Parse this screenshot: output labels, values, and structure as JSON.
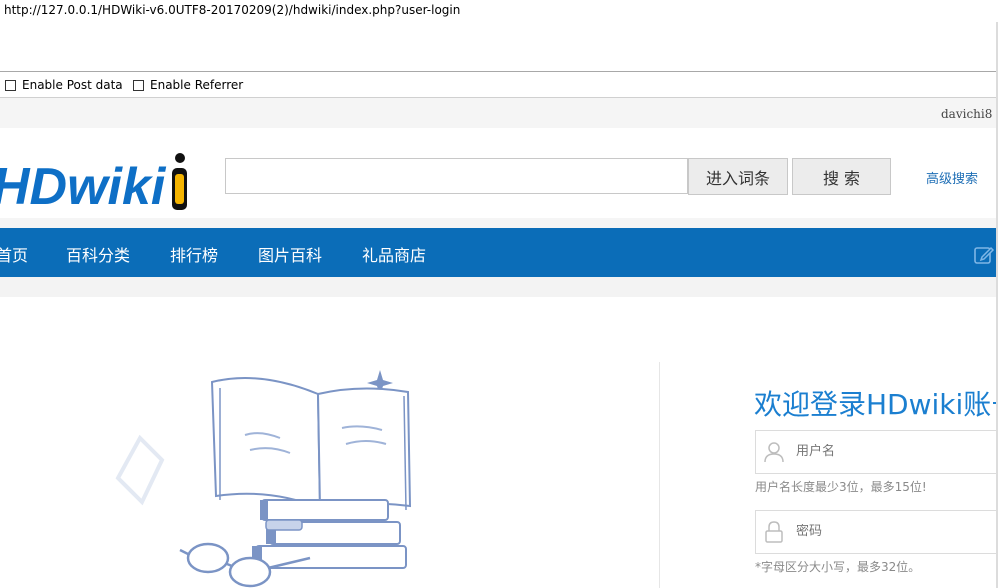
{
  "browser": {
    "url": "http://127.0.0.1/HDWiki-v6.0UTF8-20170209(2)/hdwiki/index.php?user-login"
  },
  "hackbar": {
    "enable_post": "Enable Post data",
    "enable_referrer": "Enable Referrer"
  },
  "topbar": {
    "username": "davichi8"
  },
  "logo": {
    "text": "HDwiki"
  },
  "search": {
    "placeholder": "",
    "enter_entry_label": "进入词条",
    "search_label": "搜 索",
    "advanced_label": "高级搜索"
  },
  "nav": {
    "items": [
      {
        "label": "首页"
      },
      {
        "label": "百科分类"
      },
      {
        "label": "排行榜"
      },
      {
        "label": "图片百科"
      },
      {
        "label": "礼品商店"
      }
    ]
  },
  "login": {
    "title": "欢迎登录HDwiki账号",
    "username_placeholder": "用户名",
    "username_hint": "用户名长度最少3位，最多15位!",
    "password_placeholder": "密码",
    "password_hint": "*字母区分大小写，最多32位。"
  },
  "colors": {
    "nav_bg": "#0b6db8",
    "accent": "#1b7fd0",
    "logo_blue": "#0e6fc6",
    "logo_yellow": "#f5b400"
  }
}
